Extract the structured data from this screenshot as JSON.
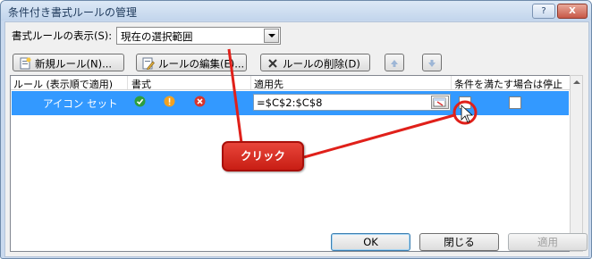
{
  "window": {
    "title": "条件付き書式ルールの管理",
    "help_label": "?",
    "close_label": "X"
  },
  "show": {
    "label": "書式ルールの表示(S):",
    "selected": "現在の選択範囲"
  },
  "toolbar": {
    "new_label": "新規ルール(N)...",
    "edit_label": "ルールの編集(E)...",
    "delete_label": "ルールの削除(D)"
  },
  "table": {
    "headers": [
      "ルール (表示順で適用)",
      "書式",
      "適用先",
      "条件を満たす場合は停止"
    ],
    "rows": [
      {
        "rule": "アイコン セット",
        "applies_to": "=$C$2:$C$8",
        "stop_if_true": false
      }
    ]
  },
  "footer": {
    "ok_label": "OK",
    "close_label": "閉じる",
    "apply_label": "適用"
  },
  "annotation": {
    "text": "クリック",
    "color": "#e0201a"
  },
  "colors": {
    "selection": "#3399ff",
    "icon_green": "#2e9e3e",
    "icon_yellow": "#f2a11f",
    "icon_red": "#d9342b"
  }
}
